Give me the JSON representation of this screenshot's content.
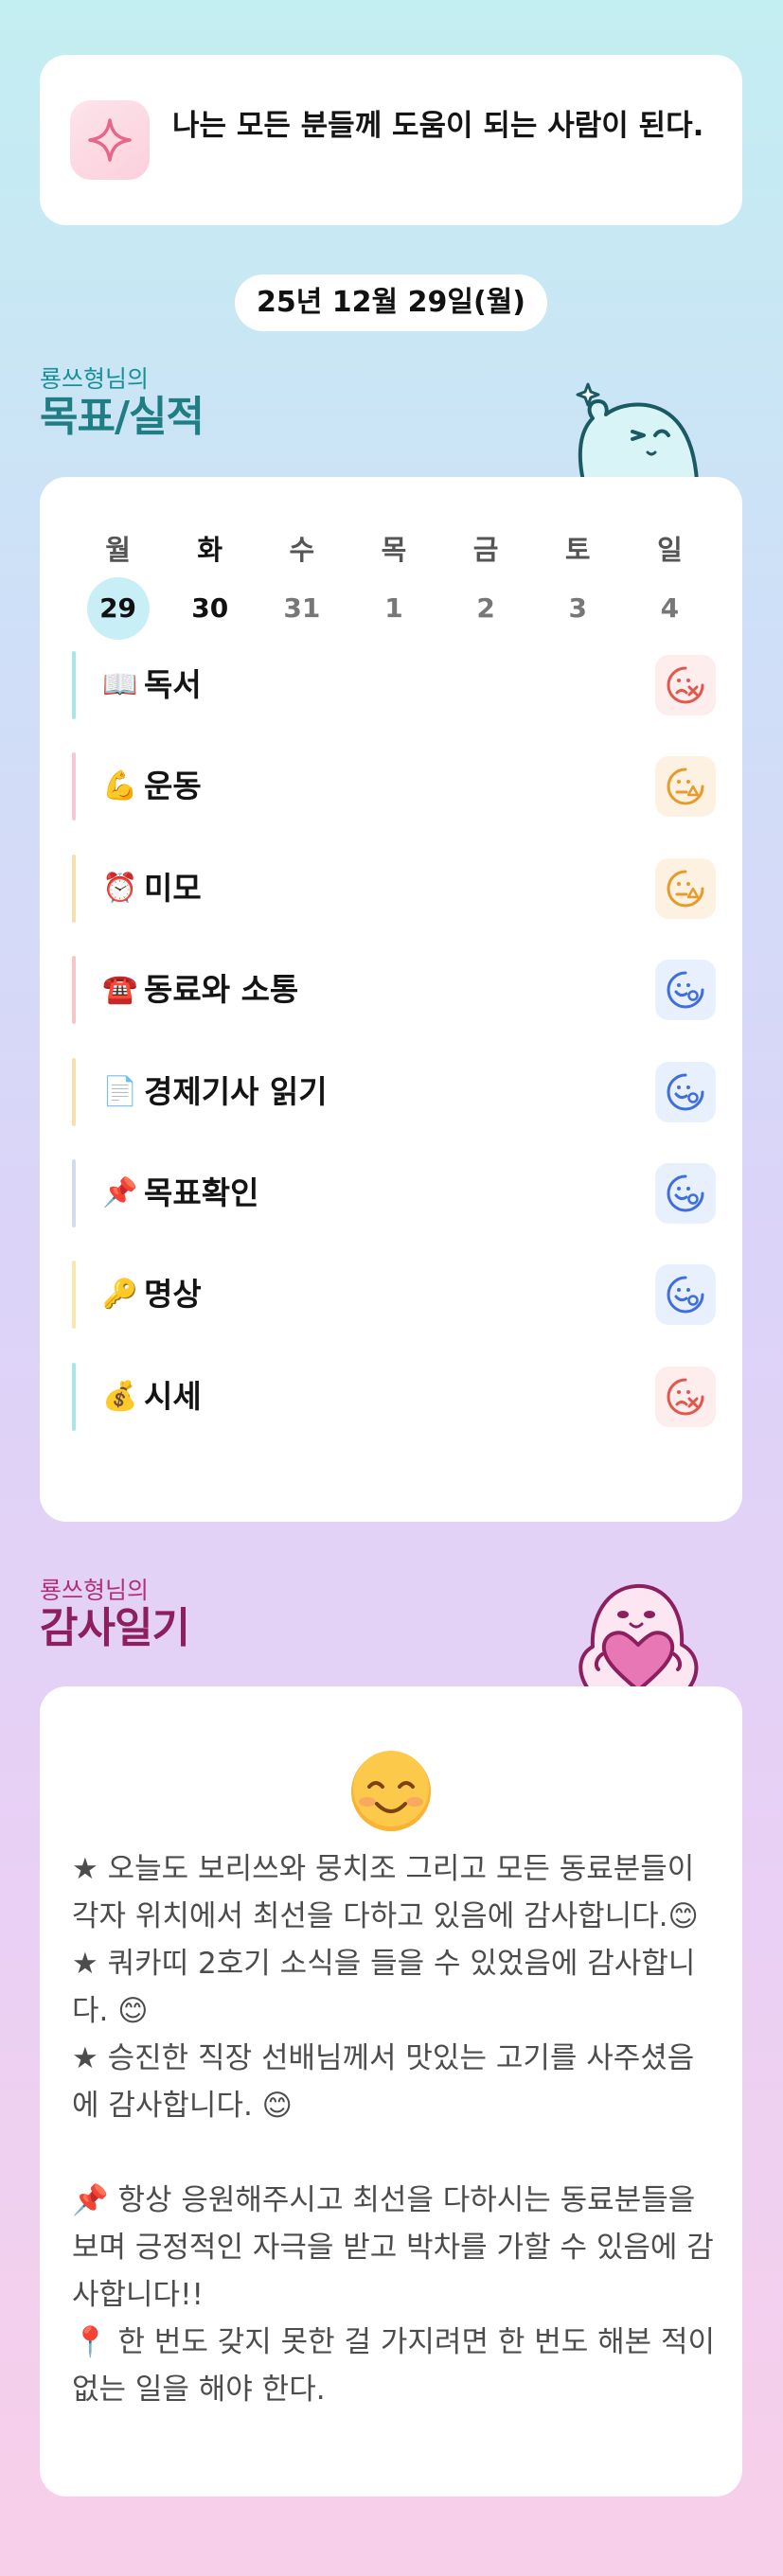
{
  "motto": {
    "text": "나는 모든 분들께 도움이 되는 사람이 된다."
  },
  "date": "25년 12월 29일(월)",
  "goals_section": {
    "subtitle": "룡쓰형님의",
    "title": "목표/실적"
  },
  "week": {
    "weekdays": [
      "월",
      "화",
      "수",
      "목",
      "금",
      "토",
      "일"
    ],
    "dates": [
      "29",
      "30",
      "31",
      "1",
      "2",
      "3",
      "4"
    ],
    "selected_index": 0
  },
  "goals": [
    {
      "emoji": "📖",
      "label": "독서",
      "status": "fail",
      "bar_color": "#a9e6e6"
    },
    {
      "emoji": "💪",
      "label": "운동",
      "status": "partial",
      "bar_color": "#f7c6d8"
    },
    {
      "emoji": "⏰",
      "label": "미모",
      "status": "partial",
      "bar_color": "#f7e0b0"
    },
    {
      "emoji": "☎️",
      "label": "동료와 소통",
      "status": "success",
      "bar_color": "#f7c6c6"
    },
    {
      "emoji": "📄",
      "label": "경제기사 읽기",
      "status": "success",
      "bar_color": "#f7e0b0"
    },
    {
      "emoji": "📌",
      "label": "목표확인",
      "status": "success",
      "bar_color": "#d3dcef"
    },
    {
      "emoji": "🔑",
      "label": "명상",
      "status": "success",
      "bar_color": "#f7e8b0"
    },
    {
      "emoji": "💰",
      "label": "시세",
      "status": "fail",
      "bar_color": "#a9e6e6"
    }
  ],
  "status_icons": {
    "fail": {
      "name": "sad-face-x-icon",
      "color": "#e2574c",
      "bg": "#fdeeed"
    },
    "partial": {
      "name": "neutral-face-triangle-icon",
      "color": "#e89a2a",
      "bg": "#fdf2e2"
    },
    "success": {
      "name": "smile-face-circle-icon",
      "color": "#3e6ee0",
      "bg": "#e9f0fd"
    }
  },
  "gratitude_section": {
    "subtitle": "룡쓰형님의",
    "title": "감사일기"
  },
  "gratitude": {
    "face_emoji": "😊",
    "body": "★ 오늘도 보리쓰와 뭉치조 그리고 모든 동료분들이 각자 위치에서 최선을 다하고 있음에 감사합니다.😊\n★ 쿼카띠 2호기 소식을 들을 수 있었음에 감사합니다. 😊\n★ 승진한 직장 선배님께서 맛있는 고기를 사주셨음에 감사합니다. 😊\n\n📌 항상 응원해주시고 최선을 다하시는 동료분들을 보며 긍정적인 자극을 받고 박차를 가할 수 있음에 감사합니다!!\n📍 한 번도 갖지 못한 걸 가지려면 한 번도 해본 적이 없는 일을 해야 한다."
  },
  "colors": {
    "goals_title": "#1f7e84",
    "gratitude_title": "#8d1f5e",
    "selected_date_bg": "#c8eff5"
  }
}
